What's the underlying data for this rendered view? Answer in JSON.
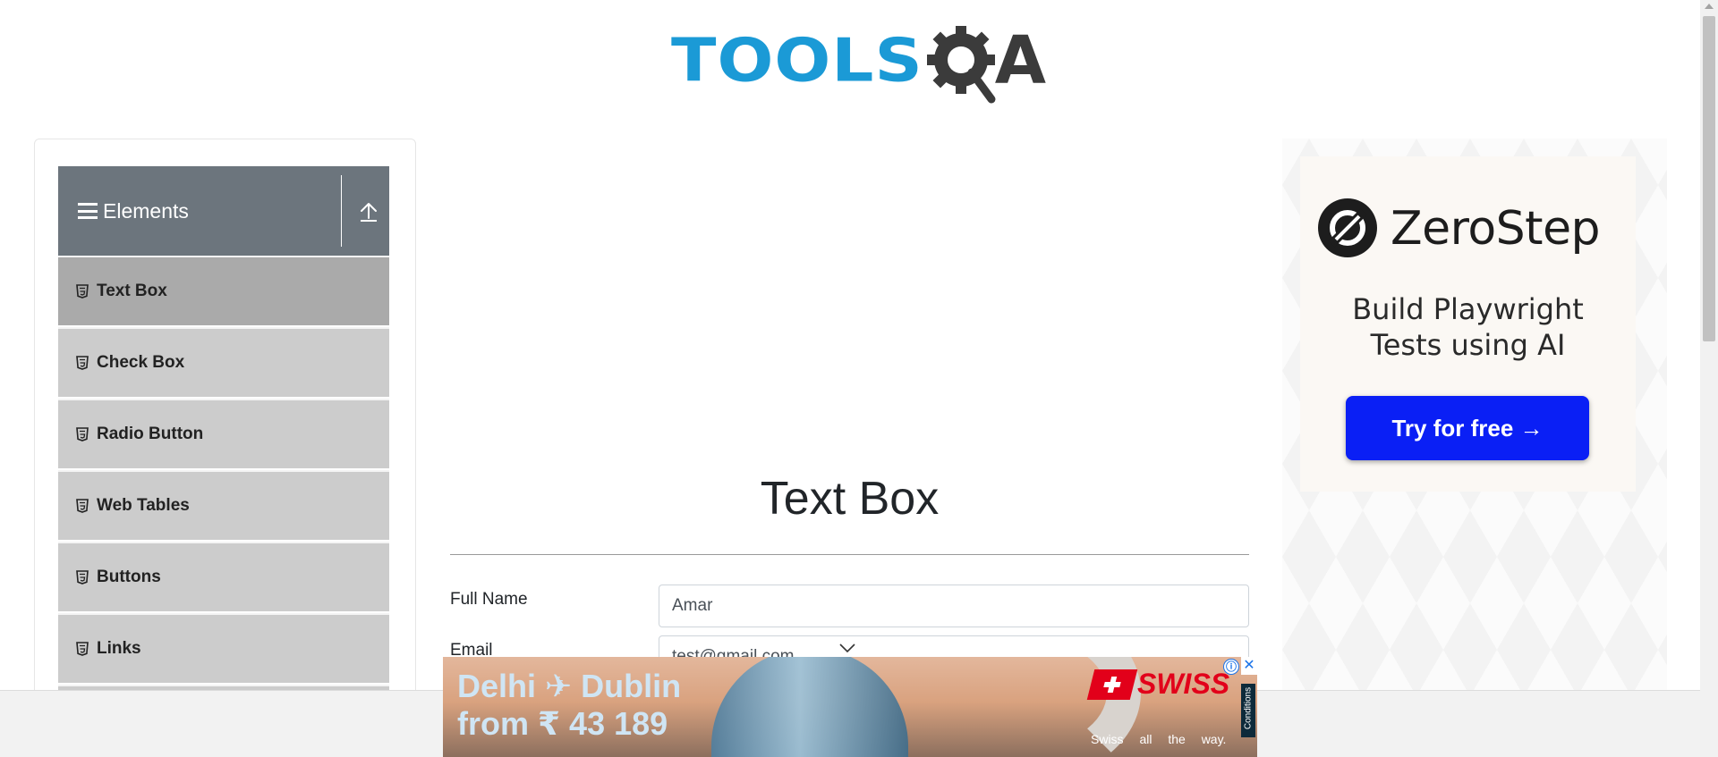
{
  "header": {
    "logo_tools": "TOOLS",
    "logo_a": "A",
    "logo_colors": {
      "tools": "#1b9ad6",
      "qa": "#3b3b3b"
    }
  },
  "sidebar": {
    "group_title": "Elements",
    "group_icons": [
      "hamburger-icon",
      "collapse-arrow-icon"
    ],
    "items": [
      {
        "label": "Text Box",
        "icon": "html5-icon",
        "active": true
      },
      {
        "label": "Check Box",
        "icon": "html5-icon",
        "active": false
      },
      {
        "label": "Radio Button",
        "icon": "html5-icon",
        "active": false
      },
      {
        "label": "Web Tables",
        "icon": "html5-icon",
        "active": false
      },
      {
        "label": "Buttons",
        "icon": "html5-icon",
        "active": false
      },
      {
        "label": "Links",
        "icon": "html5-icon",
        "active": false
      }
    ]
  },
  "main": {
    "title": "Text Box",
    "fields": [
      {
        "label": "Full Name",
        "value": "Amar"
      },
      {
        "label": "Email",
        "value": "test@gmail.com"
      }
    ]
  },
  "ad_right": {
    "brand": "ZeroStep",
    "tagline_line1": "Build Playwright",
    "tagline_line2": "Tests using AI",
    "cta": "Try for free →",
    "cta_color": "#0a1ff5"
  },
  "ad_bottom": {
    "headline_line1": "Delhi ✈ Dublin",
    "headline_line2": "from ₹ 43 189",
    "brand": "SWISS",
    "slogan": "Swiss all the way.",
    "conditions": "Conditions",
    "info_icon": "ⓘ",
    "close_icon": "✕"
  }
}
